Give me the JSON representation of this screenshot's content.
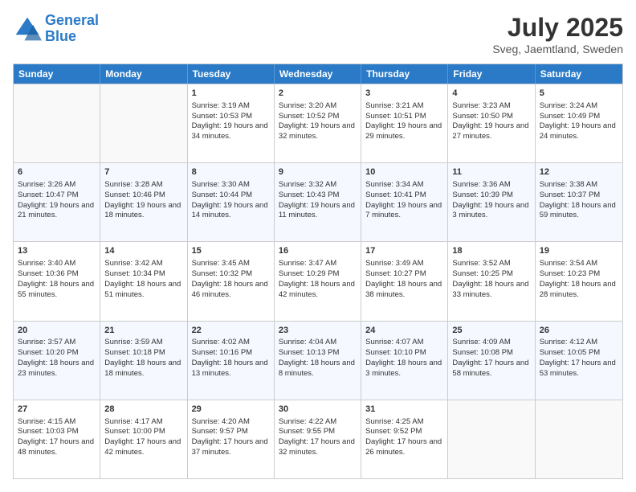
{
  "logo": {
    "line1": "General",
    "line2": "Blue"
  },
  "title": "July 2025",
  "location": "Sveg, Jaemtland, Sweden",
  "days_of_week": [
    "Sunday",
    "Monday",
    "Tuesday",
    "Wednesday",
    "Thursday",
    "Friday",
    "Saturday"
  ],
  "weeks": [
    [
      {
        "day": "",
        "sunrise": "",
        "sunset": "",
        "daylight": "",
        "empty": true
      },
      {
        "day": "",
        "sunrise": "",
        "sunset": "",
        "daylight": "",
        "empty": true
      },
      {
        "day": "1",
        "sunrise": "Sunrise: 3:19 AM",
        "sunset": "Sunset: 10:53 PM",
        "daylight": "Daylight: 19 hours and 34 minutes.",
        "empty": false
      },
      {
        "day": "2",
        "sunrise": "Sunrise: 3:20 AM",
        "sunset": "Sunset: 10:52 PM",
        "daylight": "Daylight: 19 hours and 32 minutes.",
        "empty": false
      },
      {
        "day": "3",
        "sunrise": "Sunrise: 3:21 AM",
        "sunset": "Sunset: 10:51 PM",
        "daylight": "Daylight: 19 hours and 29 minutes.",
        "empty": false
      },
      {
        "day": "4",
        "sunrise": "Sunrise: 3:23 AM",
        "sunset": "Sunset: 10:50 PM",
        "daylight": "Daylight: 19 hours and 27 minutes.",
        "empty": false
      },
      {
        "day": "5",
        "sunrise": "Sunrise: 3:24 AM",
        "sunset": "Sunset: 10:49 PM",
        "daylight": "Daylight: 19 hours and 24 minutes.",
        "empty": false
      }
    ],
    [
      {
        "day": "6",
        "sunrise": "Sunrise: 3:26 AM",
        "sunset": "Sunset: 10:47 PM",
        "daylight": "Daylight: 19 hours and 21 minutes.",
        "empty": false
      },
      {
        "day": "7",
        "sunrise": "Sunrise: 3:28 AM",
        "sunset": "Sunset: 10:46 PM",
        "daylight": "Daylight: 19 hours and 18 minutes.",
        "empty": false
      },
      {
        "day": "8",
        "sunrise": "Sunrise: 3:30 AM",
        "sunset": "Sunset: 10:44 PM",
        "daylight": "Daylight: 19 hours and 14 minutes.",
        "empty": false
      },
      {
        "day": "9",
        "sunrise": "Sunrise: 3:32 AM",
        "sunset": "Sunset: 10:43 PM",
        "daylight": "Daylight: 19 hours and 11 minutes.",
        "empty": false
      },
      {
        "day": "10",
        "sunrise": "Sunrise: 3:34 AM",
        "sunset": "Sunset: 10:41 PM",
        "daylight": "Daylight: 19 hours and 7 minutes.",
        "empty": false
      },
      {
        "day": "11",
        "sunrise": "Sunrise: 3:36 AM",
        "sunset": "Sunset: 10:39 PM",
        "daylight": "Daylight: 19 hours and 3 minutes.",
        "empty": false
      },
      {
        "day": "12",
        "sunrise": "Sunrise: 3:38 AM",
        "sunset": "Sunset: 10:37 PM",
        "daylight": "Daylight: 18 hours and 59 minutes.",
        "empty": false
      }
    ],
    [
      {
        "day": "13",
        "sunrise": "Sunrise: 3:40 AM",
        "sunset": "Sunset: 10:36 PM",
        "daylight": "Daylight: 18 hours and 55 minutes.",
        "empty": false
      },
      {
        "day": "14",
        "sunrise": "Sunrise: 3:42 AM",
        "sunset": "Sunset: 10:34 PM",
        "daylight": "Daylight: 18 hours and 51 minutes.",
        "empty": false
      },
      {
        "day": "15",
        "sunrise": "Sunrise: 3:45 AM",
        "sunset": "Sunset: 10:32 PM",
        "daylight": "Daylight: 18 hours and 46 minutes.",
        "empty": false
      },
      {
        "day": "16",
        "sunrise": "Sunrise: 3:47 AM",
        "sunset": "Sunset: 10:29 PM",
        "daylight": "Daylight: 18 hours and 42 minutes.",
        "empty": false
      },
      {
        "day": "17",
        "sunrise": "Sunrise: 3:49 AM",
        "sunset": "Sunset: 10:27 PM",
        "daylight": "Daylight: 18 hours and 38 minutes.",
        "empty": false
      },
      {
        "day": "18",
        "sunrise": "Sunrise: 3:52 AM",
        "sunset": "Sunset: 10:25 PM",
        "daylight": "Daylight: 18 hours and 33 minutes.",
        "empty": false
      },
      {
        "day": "19",
        "sunrise": "Sunrise: 3:54 AM",
        "sunset": "Sunset: 10:23 PM",
        "daylight": "Daylight: 18 hours and 28 minutes.",
        "empty": false
      }
    ],
    [
      {
        "day": "20",
        "sunrise": "Sunrise: 3:57 AM",
        "sunset": "Sunset: 10:20 PM",
        "daylight": "Daylight: 18 hours and 23 minutes.",
        "empty": false
      },
      {
        "day": "21",
        "sunrise": "Sunrise: 3:59 AM",
        "sunset": "Sunset: 10:18 PM",
        "daylight": "Daylight: 18 hours and 18 minutes.",
        "empty": false
      },
      {
        "day": "22",
        "sunrise": "Sunrise: 4:02 AM",
        "sunset": "Sunset: 10:16 PM",
        "daylight": "Daylight: 18 hours and 13 minutes.",
        "empty": false
      },
      {
        "day": "23",
        "sunrise": "Sunrise: 4:04 AM",
        "sunset": "Sunset: 10:13 PM",
        "daylight": "Daylight: 18 hours and 8 minutes.",
        "empty": false
      },
      {
        "day": "24",
        "sunrise": "Sunrise: 4:07 AM",
        "sunset": "Sunset: 10:10 PM",
        "daylight": "Daylight: 18 hours and 3 minutes.",
        "empty": false
      },
      {
        "day": "25",
        "sunrise": "Sunrise: 4:09 AM",
        "sunset": "Sunset: 10:08 PM",
        "daylight": "Daylight: 17 hours and 58 minutes.",
        "empty": false
      },
      {
        "day": "26",
        "sunrise": "Sunrise: 4:12 AM",
        "sunset": "Sunset: 10:05 PM",
        "daylight": "Daylight: 17 hours and 53 minutes.",
        "empty": false
      }
    ],
    [
      {
        "day": "27",
        "sunrise": "Sunrise: 4:15 AM",
        "sunset": "Sunset: 10:03 PM",
        "daylight": "Daylight: 17 hours and 48 minutes.",
        "empty": false
      },
      {
        "day": "28",
        "sunrise": "Sunrise: 4:17 AM",
        "sunset": "Sunset: 10:00 PM",
        "daylight": "Daylight: 17 hours and 42 minutes.",
        "empty": false
      },
      {
        "day": "29",
        "sunrise": "Sunrise: 4:20 AM",
        "sunset": "Sunset: 9:57 PM",
        "daylight": "Daylight: 17 hours and 37 minutes.",
        "empty": false
      },
      {
        "day": "30",
        "sunrise": "Sunrise: 4:22 AM",
        "sunset": "Sunset: 9:55 PM",
        "daylight": "Daylight: 17 hours and 32 minutes.",
        "empty": false
      },
      {
        "day": "31",
        "sunrise": "Sunrise: 4:25 AM",
        "sunset": "Sunset: 9:52 PM",
        "daylight": "Daylight: 17 hours and 26 minutes.",
        "empty": false
      },
      {
        "day": "",
        "sunrise": "",
        "sunset": "",
        "daylight": "",
        "empty": true
      },
      {
        "day": "",
        "sunrise": "",
        "sunset": "",
        "daylight": "",
        "empty": true
      }
    ]
  ]
}
